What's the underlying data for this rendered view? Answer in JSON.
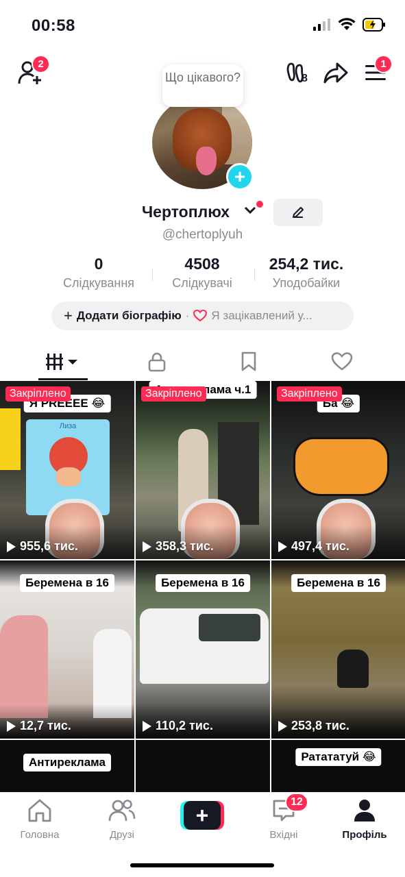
{
  "status_bar": {
    "time": "00:58",
    "icons": [
      "signal-icon",
      "wifi-icon",
      "battery-charging-icon"
    ]
  },
  "top_nav": {
    "add_friends_badge": "2",
    "menu_badge": "1",
    "footprints_count": "8"
  },
  "bubble": {
    "text": "Що цікавого?"
  },
  "profile": {
    "name": "Чертоплюх",
    "username": "@chertoplyuh"
  },
  "stats": [
    {
      "value": "0",
      "label": "Слідкування"
    },
    {
      "value": "4508",
      "label": "Слідкувачі"
    },
    {
      "value": "254,2 тис.",
      "label": "Уподобайки"
    }
  ],
  "bio": {
    "add_label": "Додати біографію",
    "separator": "·",
    "interest": "Я зацікавлений у..."
  },
  "tabs": [
    "videos-tab",
    "private-tab",
    "saved-tab",
    "liked-tab"
  ],
  "grid": {
    "pinned_label": "Закріплено",
    "items": [
      {
        "caption": "Я PREEEE 😂",
        "views": "955,6 тис.",
        "pinned": true
      },
      {
        "caption": "Антиреклама ч.1",
        "views": "358,3 тис.",
        "pinned": true
      },
      {
        "caption": "Ба 😂",
        "views": "497,4 тис.",
        "pinned": true
      },
      {
        "caption": "Беремена в 16",
        "views": "12,7 тис.",
        "pinned": false
      },
      {
        "caption": "Беремена в 16",
        "views": "110,2 тис.",
        "pinned": false
      },
      {
        "caption": "Беремена в 16",
        "views": "253,8 тис.",
        "pinned": false
      },
      {
        "caption": "Антиреклама",
        "views": "",
        "pinned": false
      },
      {
        "caption": "",
        "views": "",
        "pinned": false
      },
      {
        "caption": "Ратататуй 😂",
        "views": "",
        "pinned": false
      }
    ],
    "overlay_name": "Лиза"
  },
  "bottom_nav": {
    "home": "Головна",
    "friends": "Друзі",
    "inbox": "Вхідні",
    "inbox_badge": "12",
    "profile": "Профіль",
    "create": "+"
  },
  "colors": {
    "accent": "#fe2c55",
    "cyan": "#25f4ee",
    "text": "#161823",
    "muted": "#8a8b91"
  }
}
